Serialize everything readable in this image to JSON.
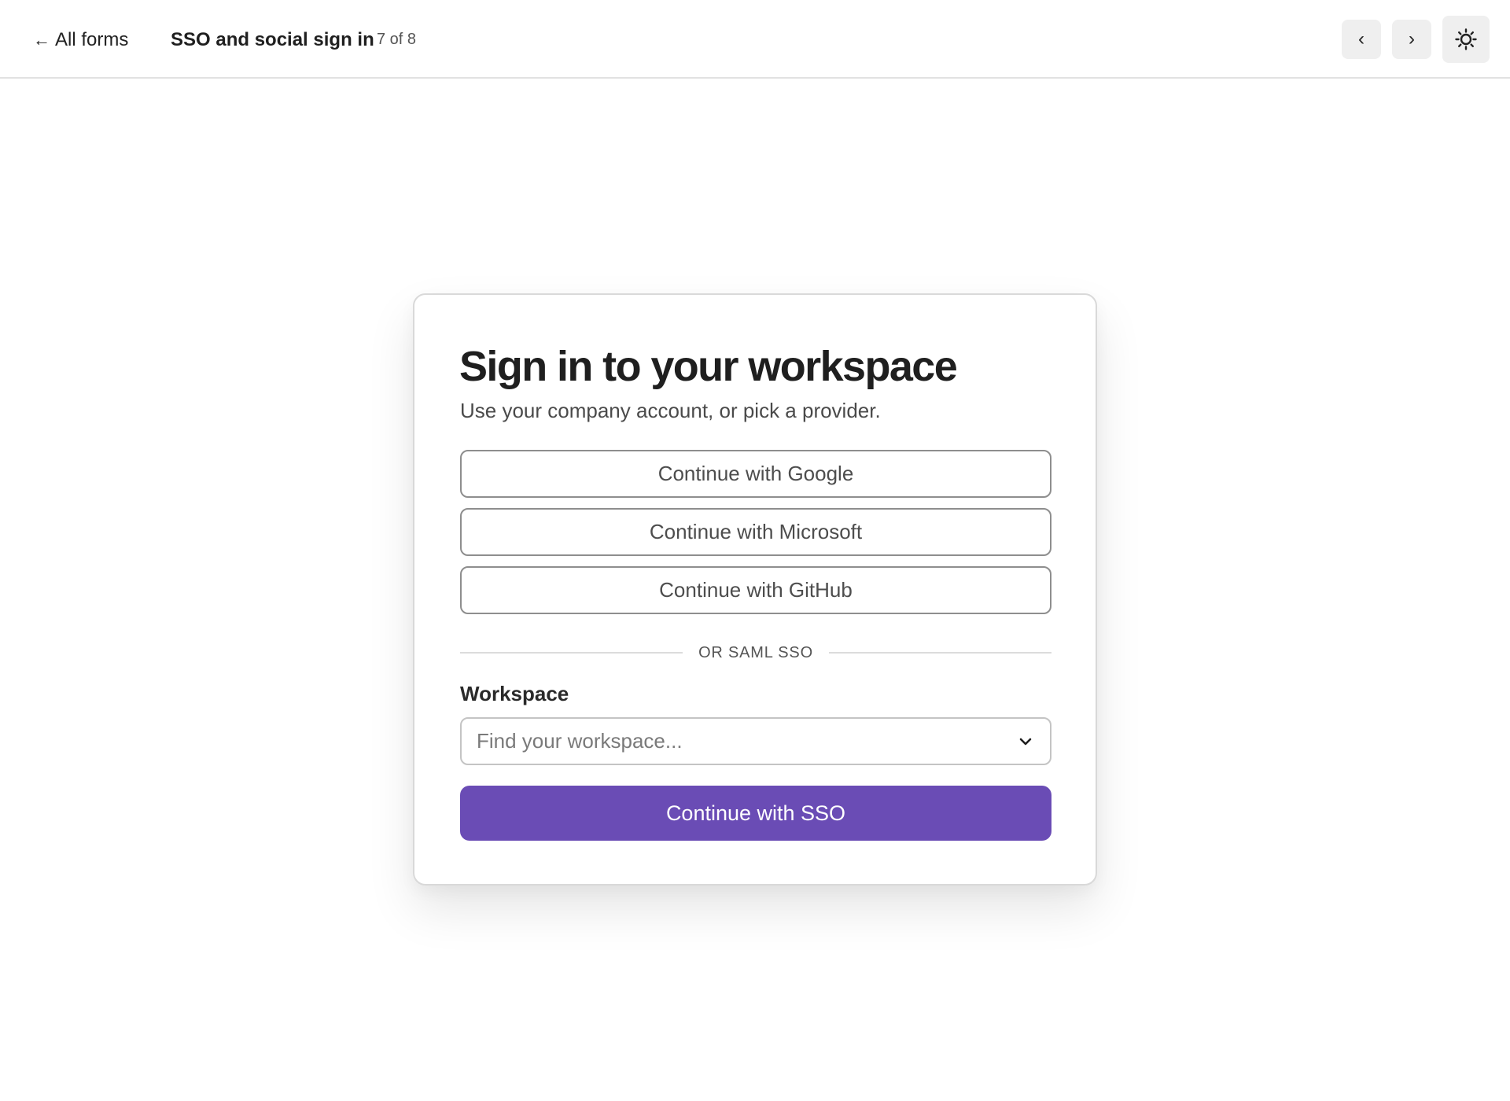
{
  "header": {
    "back_arrow": "←",
    "back_label": "All forms",
    "title": "SSO and social sign in",
    "counter": "7 of 8",
    "prev_glyph": "‹",
    "next_glyph": "›",
    "theme_icon": "sun-icon"
  },
  "card": {
    "title": "Sign in to your workspace",
    "subtitle": "Use your company account, or pick a provider.",
    "providers": [
      {
        "label": "Continue with Google"
      },
      {
        "label": "Continue with Microsoft"
      },
      {
        "label": "Continue with GitHub"
      }
    ],
    "divider_text": "OR SAML SSO",
    "workspace": {
      "label": "Workspace",
      "placeholder": "Find your workspace...",
      "value": "",
      "icon": "chevron-down-icon"
    },
    "submit_label": "Continue with SSO"
  },
  "colors": {
    "accent": "#6a4cb5",
    "border": "#8e8e8e",
    "text": "#1f1f1f",
    "muted": "#4a4a4a",
    "nav_bg": "#efefef"
  }
}
